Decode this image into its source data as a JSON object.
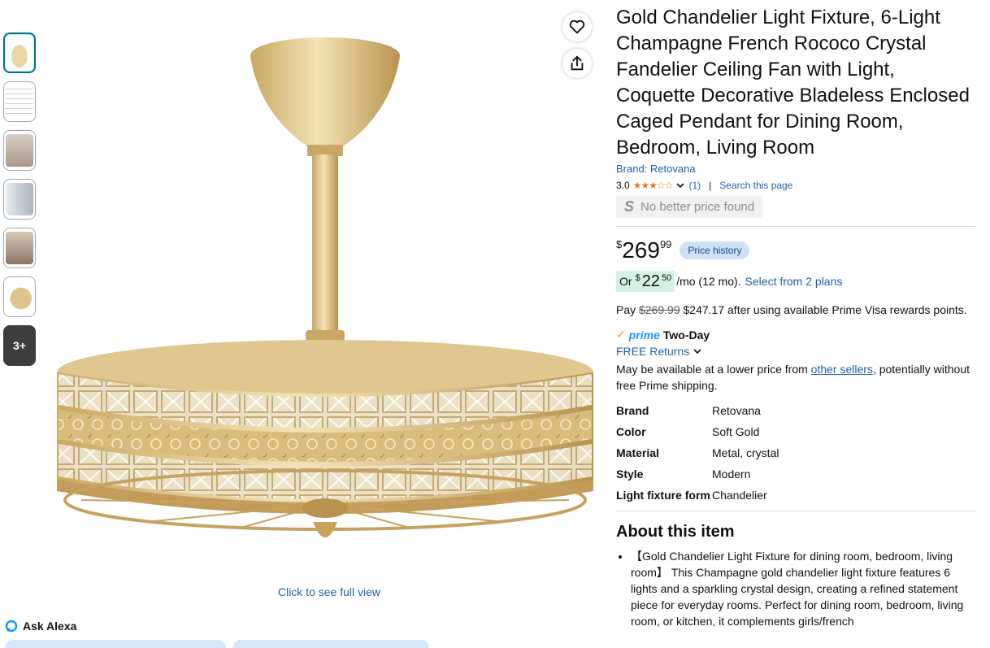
{
  "thumbnails": {
    "more_label": "3+"
  },
  "image": {
    "full_view_link": "Click to see full view"
  },
  "actions": {
    "wishlist_icon": "heart-icon",
    "share_icon": "share-icon"
  },
  "alexa": {
    "label": "Ask Alexa"
  },
  "product": {
    "title": "Gold Chandelier Light Fixture, 6-Light Champagne French Rococo Crystal Fandelier Ceiling Fan with Light, Coquette Decorative Bladeless Enclosed Caged Pendant for Dining Room, Bedroom, Living Room",
    "brand_link": "Brand: Retovana",
    "rating_value": "3.0",
    "rating_stars": "★★★☆☆",
    "rating_count": "(1)",
    "search_page": "Search this page",
    "no_better_price": "No better price found",
    "price_symbol": "$",
    "price_whole": "269",
    "price_fraction": "99",
    "price_history": "Price history",
    "monthly_or": "Or",
    "monthly_symbol": "$",
    "monthly_whole": "22",
    "monthly_fraction": "50",
    "monthly_suffix": "/mo (12 mo).",
    "monthly_plans": "Select from 2 plans",
    "pay_prefix": "Pay",
    "pay_strike": "$269.99",
    "pay_suffix": "$247.17 after using available Prime Visa rewards points.",
    "prime_label": "prime",
    "prime_speed": "Two-Day",
    "free_returns": "FREE Returns",
    "lower_text_1": "May be available at a lower price from",
    "lower_link": "other sellers",
    "lower_text_2": ", potentially without free Prime shipping.",
    "specs": [
      {
        "key": "Brand",
        "value": "Retovana"
      },
      {
        "key": "Color",
        "value": "Soft Gold"
      },
      {
        "key": "Material",
        "value": "Metal, crystal"
      },
      {
        "key": "Style",
        "value": "Modern"
      },
      {
        "key": "Light fixture form",
        "value": "Chandelier"
      }
    ],
    "about_heading": "About this item",
    "bullets": [
      "【Gold Chandelier Light Fixture for dining room, bedroom, living room】 This Champagne gold chandelier light fixture features 6 lights and a sparkling crystal design, creating a refined statement piece for everyday rooms. Perfect for dining room, bedroom, living room, or kitchen, it complements girls/french"
    ]
  },
  "colors": {
    "link": "#2162a1",
    "gold": "#d9be85",
    "price_badge_bg": "#cfe0f9",
    "monthly_bg": "#d4f2e4"
  }
}
